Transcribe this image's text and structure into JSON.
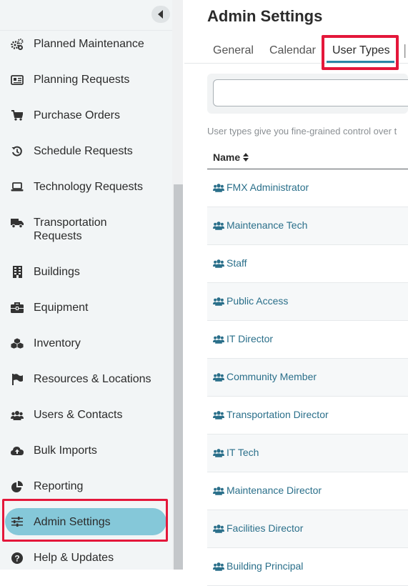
{
  "sidebar": {
    "collapse_icon": "chevron-left-icon",
    "items": [
      {
        "label": "Planned Maintenance",
        "icon": "gears-icon"
      },
      {
        "label": "Planning Requests",
        "icon": "newspaper-icon"
      },
      {
        "label": "Purchase Orders",
        "icon": "cart-icon"
      },
      {
        "label": "Schedule Requests",
        "icon": "history-icon"
      },
      {
        "label": "Technology Requests",
        "icon": "laptop-icon"
      },
      {
        "label": "Transportation Requests",
        "label_line1": "Transportation",
        "label_line2": "Requests",
        "icon": "truck-icon"
      },
      {
        "label": "Buildings",
        "icon": "building-icon"
      },
      {
        "label": "Equipment",
        "icon": "toolbox-icon"
      },
      {
        "label": "Inventory",
        "icon": "cubes-icon"
      },
      {
        "label": "Resources & Locations",
        "icon": "flag-icon"
      },
      {
        "label": "Users & Contacts",
        "icon": "users-icon"
      },
      {
        "label": "Bulk Imports",
        "icon": "cloud-upload-icon"
      },
      {
        "label": "Reporting",
        "icon": "pie-chart-icon"
      },
      {
        "label": "Admin Settings",
        "icon": "sliders-icon",
        "active": true
      },
      {
        "label": "Help & Updates",
        "icon": "question-circle-icon"
      }
    ]
  },
  "main": {
    "title": "Admin Settings",
    "tabs": [
      {
        "label": "General"
      },
      {
        "label": "Calendar"
      },
      {
        "label": "User Types",
        "active": true
      }
    ],
    "search": {
      "value": "",
      "placeholder": ""
    },
    "description": "User types give you fine-grained control over t",
    "table": {
      "column_name": "Name",
      "rows": [
        "FMX Administrator",
        "Maintenance Tech",
        "Staff",
        "Public Access",
        "IT Director",
        "Community Member",
        "Transportation Director",
        "IT Tech",
        "Maintenance Director",
        "Facilities Director",
        "Building Principal"
      ]
    }
  },
  "colors": {
    "accent": "#2a86a6",
    "active_pill": "#85c8d9",
    "highlight": "#e4173a",
    "link": "#2a6f8a"
  }
}
